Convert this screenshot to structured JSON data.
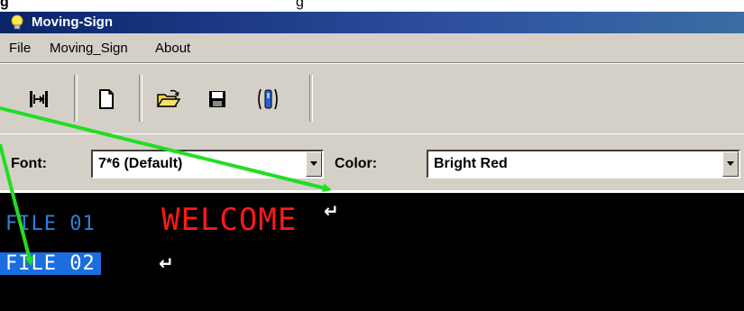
{
  "caption": {
    "bold_text": "g",
    "tail_text": "g"
  },
  "window": {
    "title": "Moving-Sign"
  },
  "menu": {
    "items": [
      "File",
      "Moving_Sign",
      "About"
    ]
  },
  "toolbar": {
    "buttons": [
      {
        "icon": "connect-icon"
      },
      {
        "icon": "new-file-icon"
      },
      {
        "icon": "open-folder-icon"
      },
      {
        "icon": "save-disk-icon"
      },
      {
        "icon": "send-sign-icon"
      }
    ]
  },
  "font_bar": {
    "font_label": "Font:",
    "font_value": "7*6 (Default)",
    "color_label": "Color:",
    "color_value": "Bright Red"
  },
  "editor": {
    "file1": "FILE 01",
    "file2": "FILE 02",
    "message": "WELCOME",
    "return_symbol": "↵",
    "message_color": "#ff1a1a",
    "file1_color": "#2f7fd8",
    "selection_color": "#1a6ee0"
  },
  "annotation": {
    "arrow_color": "#22dd22"
  }
}
